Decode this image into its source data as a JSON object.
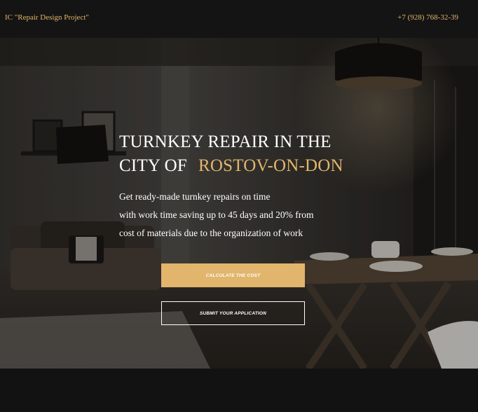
{
  "header": {
    "brand": "IC \"Repair Design Project\"",
    "phone": "+7 (928) 768-32-39"
  },
  "hero": {
    "headline_line1": "TURNKEY REPAIR IN THE",
    "headline_line2_prefix": "CITY OF",
    "headline_line2_city": "ROSTOV-ON-DON",
    "description": [
      "Get ready-made turnkey repairs on time",
      "with work time saving up to 45 days and 20% from",
      "cost of materials due to the organization of work"
    ],
    "primary_button": "CALCULATE THE COST",
    "secondary_button": "SUBMIT YOUR APPLICATION"
  },
  "colors": {
    "accent": "#e2b56c",
    "header_bg": "#141414",
    "text": "#ffffff"
  }
}
